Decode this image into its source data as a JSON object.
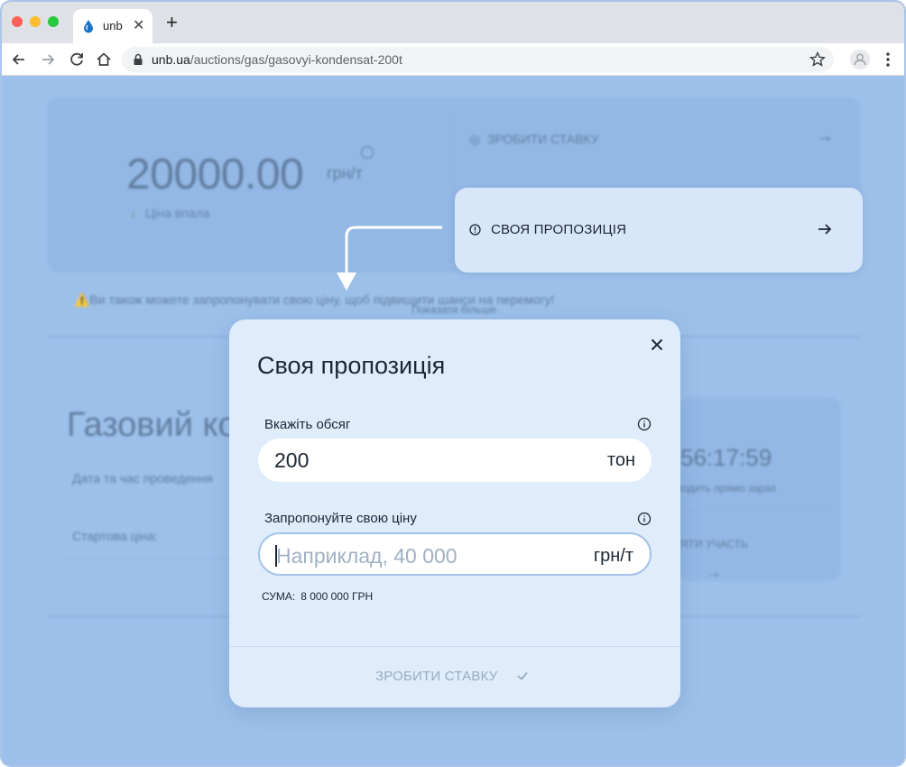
{
  "browser": {
    "tab_title": "unb",
    "tab_close": "✕",
    "new_tab": "+",
    "url_host": "unb.ua",
    "url_path": "/auctions/gas/gasovyi-kondensat-200t"
  },
  "background": {
    "price": "20000.00",
    "price_unit": "грн/т",
    "price_status": "Ціна впала",
    "make_bid": "ЗРОБИТИ СТАВКУ",
    "hint": "⚠️Ви також можете запропонувати свою ціну, щоб підвищити шанси на перемогу!",
    "show_more": "Показати більше",
    "lot_title": "Газовий ко",
    "lot_date_label": "Дата та час проведення",
    "lot_start_label": "Стартова ціна:",
    "timer": "56:17:59",
    "timer_sub": "ходить прямо зараз",
    "join": "ЯТИ УЧАСТЬ"
  },
  "offer_option": {
    "label": "СВОЯ ПРОПОЗИЦІЯ"
  },
  "modal": {
    "title": "Своя пропозиція",
    "volume_label": "Вкажіть обсяг",
    "volume_value": "200",
    "volume_unit": "тон",
    "price_label": "Запропонуйте свою ціну",
    "price_placeholder": "Наприклад, 40 000",
    "price_unit": "грн/т",
    "sum_label": "СУМА:",
    "sum_value": "8 000 000 ГРН",
    "submit": "ЗРОБИТИ СТАВКУ"
  },
  "colors": {
    "overlay": "#9dc0ea",
    "modal_bg": "#deecfb",
    "highlight_bg": "#d7e7f9",
    "focus_border": "#a4c3ea"
  }
}
